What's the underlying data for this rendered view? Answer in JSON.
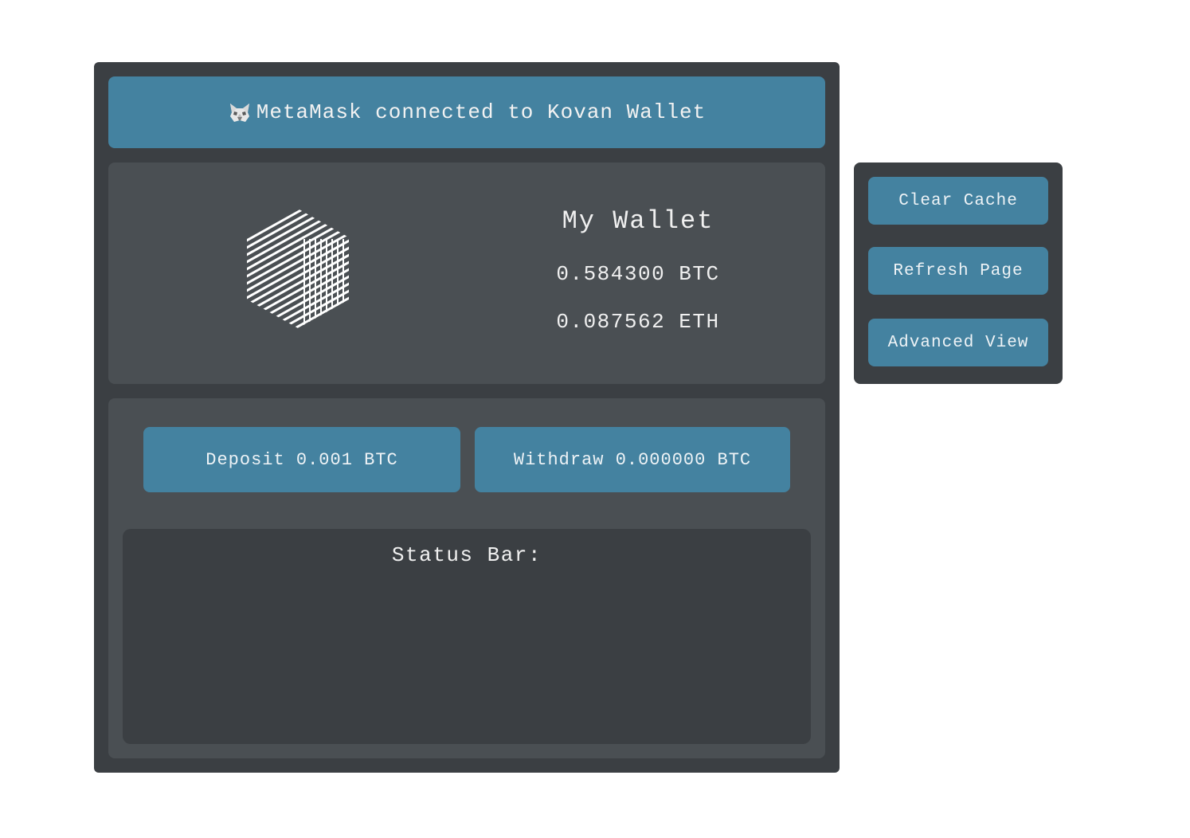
{
  "banner": {
    "icon": "metamask-fox-icon",
    "text": "MetaMask connected to Kovan Wallet"
  },
  "wallet": {
    "logo_icon": "striped-cube-logo",
    "title": "My Wallet",
    "btc_balance": "0.584300 BTC",
    "eth_balance": "0.087562 ETH"
  },
  "actions": {
    "deposit_label": "Deposit 0.001 BTC",
    "withdraw_label": "Withdraw 0.000000 BTC"
  },
  "status": {
    "title": "Status Bar:"
  },
  "side_menu": {
    "clear_cache": "Clear Cache",
    "refresh_page": "Refresh Page",
    "advanced_view": "Advanced View"
  },
  "colors": {
    "accent": "#4482a0",
    "panel": "#3b3f43",
    "card": "#4a4f53",
    "text": "#f0f0f0"
  }
}
